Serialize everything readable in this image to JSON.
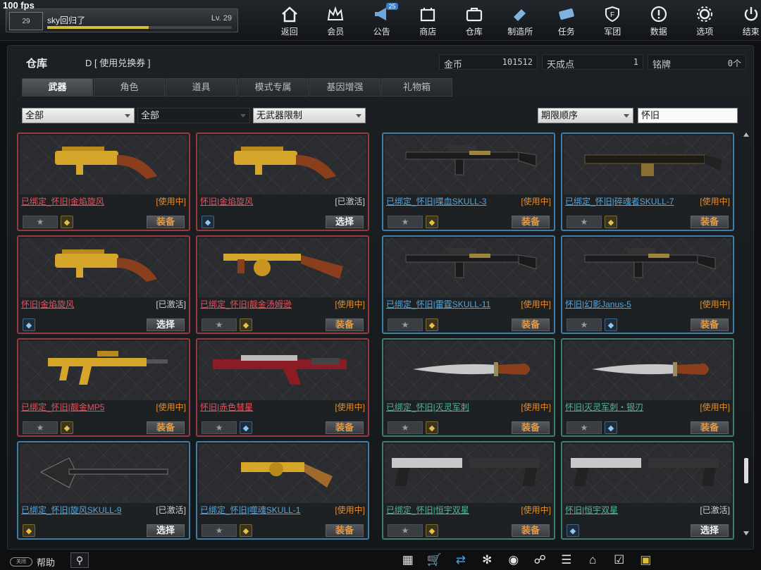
{
  "fps": "100 fps",
  "profile": {
    "level_icon": "29",
    "name": "sky回归了",
    "level": "Lv. 29",
    "xp_fraction": 0.55
  },
  "nav": [
    {
      "label": "返回",
      "icon": "home-icon"
    },
    {
      "label": "会员",
      "icon": "crown-icon"
    },
    {
      "label": "公告",
      "icon": "megaphone-icon",
      "badge": "25"
    },
    {
      "label": "商店",
      "icon": "shop-icon"
    },
    {
      "label": "仓库",
      "icon": "briefcase-icon"
    },
    {
      "label": "制造所",
      "icon": "craft-icon"
    },
    {
      "label": "任务",
      "icon": "mission-icon"
    },
    {
      "label": "军团",
      "icon": "clan-shield-icon"
    },
    {
      "label": "数据",
      "icon": "info-icon"
    },
    {
      "label": "选项",
      "icon": "gear-icon"
    },
    {
      "label": "结束",
      "icon": "power-icon"
    }
  ],
  "panel": {
    "title": "仓库",
    "voucher": "D [ 使用兑换券 ]"
  },
  "currency": [
    {
      "name": "金币",
      "value": "101512"
    },
    {
      "name": "天成点",
      "value": "1"
    },
    {
      "name": "铭牌",
      "value": "0个"
    }
  ],
  "tabs": [
    "武器",
    "角色",
    "道具",
    "模式专属",
    "基因增强",
    "礼物箱"
  ],
  "filters": {
    "category": "全部",
    "subcategory": "全部",
    "restriction": "无武器限制",
    "sort": "期限顺序",
    "search": "怀旧"
  },
  "items": [
    {
      "name": "已绑定_怀旧|金焰旋风",
      "status": "[使用中]",
      "action": "装备",
      "star": "★",
      "lock": "gold",
      "color": "red"
    },
    {
      "name": "怀旧|金焰旋风",
      "status": "[已激活]",
      "action": "选择",
      "star": "",
      "lock": "blue",
      "color": "red"
    },
    {
      "name": "已绑定_怀旧|喋血SKULL-3",
      "status": "[使用中]",
      "action": "装备",
      "star": "★",
      "lock": "gold",
      "color": "blue"
    },
    {
      "name": "已绑定_怀旧|碎魂者SKULL-7",
      "status": "[使用中]",
      "action": "装备",
      "star": "★",
      "lock": "gold",
      "color": "blue"
    },
    {
      "name": "怀旧|金焰旋风",
      "status": "[已激活]",
      "action": "选择",
      "star": "",
      "lock": "blue",
      "color": "red"
    },
    {
      "name": "已绑定_怀旧|靓金汤姆逊",
      "status": "[使用中]",
      "action": "装备",
      "star": "★",
      "lock": "gold",
      "color": "red"
    },
    {
      "name": "已绑定_怀旧|雷霆SKULL-11",
      "status": "[使用中]",
      "action": "装备",
      "star": "★",
      "lock": "gold",
      "color": "blue"
    },
    {
      "name": "怀旧|幻影Janus-5",
      "status": "[使用中]",
      "action": "装备",
      "star": "★",
      "lock": "blue",
      "color": "blue"
    },
    {
      "name": "已绑定_怀旧|靓金MP5",
      "status": "[使用中]",
      "action": "装备",
      "star": "★",
      "lock": "gold",
      "color": "red"
    },
    {
      "name": "怀旧|赤色彗星",
      "status": "[使用中]",
      "action": "装备",
      "star": "★",
      "lock": "blue",
      "color": "red"
    },
    {
      "name": "已绑定_怀旧|灭灵军刺",
      "status": "[使用中]",
      "action": "装备",
      "star": "★",
      "lock": "gold",
      "color": "green"
    },
    {
      "name": "怀旧|灭灵军刺・银刃",
      "status": "[使用中]",
      "action": "装备",
      "star": "★",
      "lock": "blue",
      "color": "green"
    },
    {
      "name": "已绑定_怀旧|旋风SKULL-9",
      "status": "[已激活]",
      "action": "选择",
      "star": "",
      "lock": "gold",
      "color": "blue"
    },
    {
      "name": "已绑定_怀旧|噬魂SKULL-1",
      "status": "[使用中]",
      "action": "装备",
      "star": "★",
      "lock": "gold",
      "color": "blue"
    },
    {
      "name": "已绑定_怀旧|恒宇双星",
      "status": "[使用中]",
      "action": "装备",
      "star": "★",
      "lock": "gold",
      "color": "green"
    },
    {
      "name": "怀旧|恒宇双星",
      "status": "[已激活]",
      "action": "选择",
      "star": "",
      "lock": "blue",
      "color": "green"
    }
  ],
  "bottom": {
    "toggle": "关闭",
    "help": "帮助"
  }
}
